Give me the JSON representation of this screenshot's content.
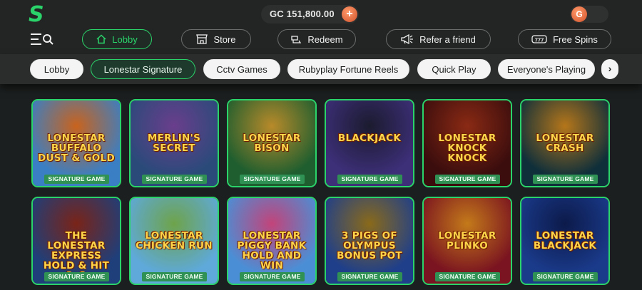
{
  "header": {
    "balance_text": "GC 151,800.00",
    "add_coins_symbol": "+",
    "currency_toggle_letter": "G"
  },
  "nav": {
    "items": [
      {
        "label": "Lobby",
        "icon": "home-icon",
        "active": true
      },
      {
        "label": "Store",
        "icon": "store-icon"
      },
      {
        "label": "Redeem",
        "icon": "redeem-icon"
      },
      {
        "label": "Refer a friend",
        "icon": "megaphone-icon"
      },
      {
        "label": "Free Spins",
        "icon": "slot-777-icon"
      }
    ]
  },
  "categories": {
    "items": [
      "Lobby",
      "Lonestar Signature",
      "Cctv Games",
      "Rubyplay Fortune Reels",
      "Quick Play",
      "Everyone's Playing"
    ],
    "active_index": 1,
    "next_symbol": "›"
  },
  "games": [
    {
      "title": "LONESTAR BUFFALO DUST & GOLD",
      "badge": "SIGNATURE GAME",
      "bg": "#3a7fc4",
      "bg2": "#c9631d"
    },
    {
      "title": "MERLIN'S SECRET",
      "badge": "SIGNATURE GAME",
      "bg": "#2a4a7a",
      "bg2": "#6a3e8c"
    },
    {
      "title": "LONESTAR BISON",
      "badge": "SIGNATURE GAME",
      "bg": "#1f5e2f",
      "bg2": "#b88a2a"
    },
    {
      "title": "BLACKJACK",
      "badge": "SIGNATURE GAME",
      "bg": "#3d2f78",
      "bg2": "#1b1b2f"
    },
    {
      "title": "LONESTAR KNOCK KNOCK",
      "badge": "SIGNATURE GAME",
      "bg": "#3b0d0d",
      "bg2": "#8a2a14"
    },
    {
      "title": "LONESTAR CRASH",
      "badge": "SIGNATURE GAME",
      "bg": "#0f2f3a",
      "bg2": "#b5761a"
    },
    {
      "title": "THE LONESTAR EXPRESS HOLD & HIT 3x3",
      "badge": "SIGNATURE GAME",
      "bg": "#1f3f7a",
      "bg2": "#7a2418"
    },
    {
      "title": "LONESTAR CHICKEN RUN",
      "badge": "SIGNATURE GAME",
      "bg": "#5ea9d9",
      "bg2": "#6ea34a"
    },
    {
      "title": "LONESTAR PIGGY BANK HOLD AND WIN",
      "badge": "SIGNATURE GAME",
      "bg": "#4a8fd6",
      "bg2": "#c2447a"
    },
    {
      "title": "3 PIGS OF OLYMPUS BONUS POT",
      "badge": "SIGNATURE GAME",
      "bg": "#1f3f8a",
      "bg2": "#8a6a1a"
    },
    {
      "title": "LONESTAR PLINKO",
      "badge": "SIGNATURE GAME",
      "bg": "#7a1420",
      "bg2": "#c47a1a"
    },
    {
      "title": "LONESTAR BLACKJACK",
      "badge": "SIGNATURE GAME",
      "bg": "#1a3a8a",
      "bg2": "#0c1a4a"
    }
  ]
}
